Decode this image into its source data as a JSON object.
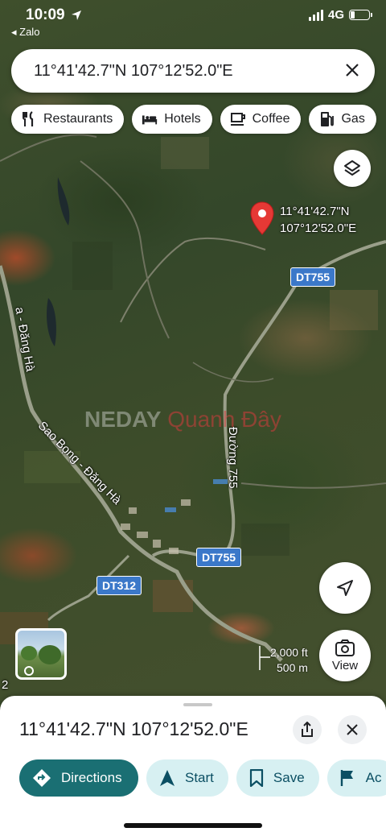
{
  "status": {
    "time": "10:09",
    "back_app": "◂ Zalo",
    "network": "4G"
  },
  "search": {
    "query": "11°41'42.7\"N 107°12'52.0\"E"
  },
  "chips": [
    {
      "label": "Restaurants",
      "icon": "fork-knife-icon"
    },
    {
      "label": "Hotels",
      "icon": "bed-icon"
    },
    {
      "label": "Coffee",
      "icon": "coffee-cup-icon"
    },
    {
      "label": "Gas",
      "icon": "gas-pump-icon"
    }
  ],
  "pin": {
    "line1": "11°41'42.7\"N",
    "line2": "107°12'52.0\"E",
    "color": "#e53935"
  },
  "map": {
    "road_labels": [
      "DT755",
      "DT755",
      "DT312"
    ],
    "place_labels": [
      "Sao Bọng - Đăng Hà",
      "Đường 755",
      "a - Đăng Hà",
      "2"
    ],
    "watermark": "Quanh Đây",
    "watermark_prefix": "NEDAY",
    "scale_ft": "2,000 ft",
    "scale_m": "500 m",
    "view_label": "View"
  },
  "sheet": {
    "title": "11°41'42.7\"N 107°12'52.0\"E",
    "actions": [
      {
        "label": "Directions",
        "icon": "directions-icon"
      },
      {
        "label": "Start",
        "icon": "navigation-arrow-icon"
      },
      {
        "label": "Save",
        "icon": "bookmark-icon"
      },
      {
        "label": "Ac",
        "icon": "flag-icon"
      }
    ]
  },
  "colors": {
    "primary": "#1a6f73",
    "secondary": "#d7f0f2",
    "road_shield": "#3b78c9"
  }
}
